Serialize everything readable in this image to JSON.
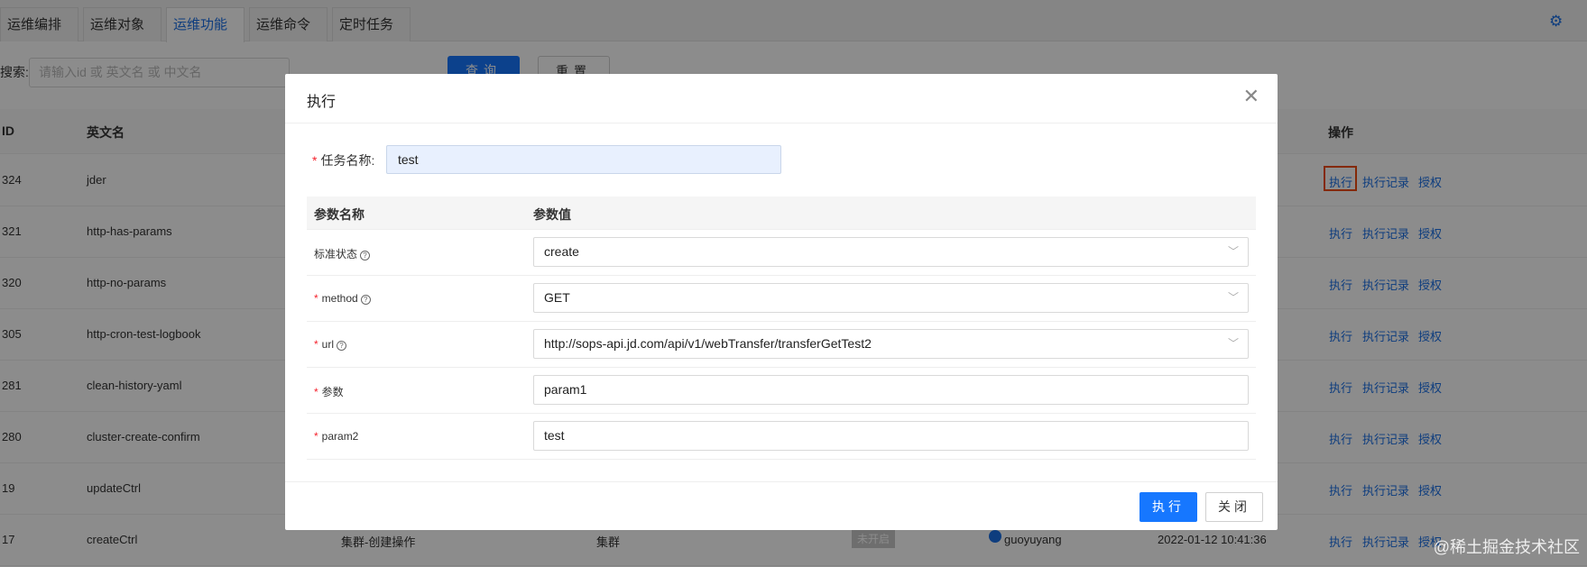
{
  "tabs": [
    "运维编排",
    "运维对象",
    "运维功能",
    "运维命令",
    "定时任务"
  ],
  "active_tab": 2,
  "search": {
    "label": "搜索:",
    "placeholder": "请输入id 或 英文名 或 中文名"
  },
  "buttons": {
    "query": "查询",
    "reset": "重置"
  },
  "table": {
    "headers": {
      "id": "ID",
      "name": "英文名",
      "ops": "操作"
    },
    "rows": [
      {
        "id": "324",
        "name": "jder"
      },
      {
        "id": "321",
        "name": "http-has-params"
      },
      {
        "id": "320",
        "name": "http-no-params"
      },
      {
        "id": "305",
        "name": "http-cron-test-logbook"
      },
      {
        "id": "281",
        "name": "clean-history-yaml"
      },
      {
        "id": "280",
        "name": "cluster-create-confirm"
      },
      {
        "id": "19",
        "name": "updateCtrl"
      },
      {
        "id": "17",
        "name": "createCtrl",
        "type": "集群-创建操作",
        "object": "集群",
        "status": "未开启",
        "user": "guoyuyang",
        "time": "2022-01-12 10:41:36"
      }
    ],
    "ops": {
      "exec": "执行",
      "records": "执行记录",
      "auth": "授权"
    }
  },
  "watermark": "@稀土掘金技术社区",
  "modal": {
    "title": "执行",
    "task_label": "任务名称:",
    "task_value": "test",
    "param_headers": {
      "name": "参数名称",
      "value": "参数值"
    },
    "params": [
      {
        "label": "标准状态",
        "required": false,
        "help": true,
        "value": "create",
        "select": true
      },
      {
        "label": "method",
        "required": true,
        "help": true,
        "value": "GET",
        "select": true
      },
      {
        "label": "url",
        "required": true,
        "help": true,
        "value": "http://sops-api.jd.com/api/v1/webTransfer/transferGetTest2",
        "select": true
      },
      {
        "label": "参数",
        "required": true,
        "help": false,
        "value": "param1",
        "select": false
      },
      {
        "label": "param2",
        "required": true,
        "help": false,
        "value": "test",
        "select": false
      }
    ],
    "exec_button": "执行",
    "close_button": "关闭"
  }
}
